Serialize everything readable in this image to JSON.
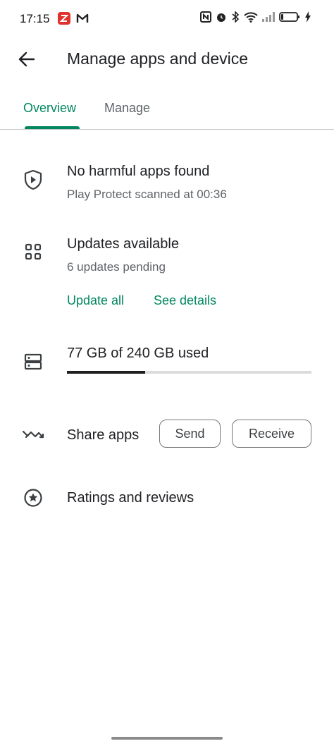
{
  "status_bar": {
    "time": "17:15",
    "left_icons": [
      "zoho-app-icon",
      "gmail-icon"
    ],
    "right_icons": [
      "nfc-icon",
      "alarm-icon",
      "bluetooth-icon",
      "wifi-icon",
      "signal-icon",
      "battery-icon",
      "charging-icon"
    ]
  },
  "header": {
    "title": "Manage apps and device"
  },
  "tabs": [
    {
      "label": "Overview",
      "selected": true
    },
    {
      "label": "Manage",
      "selected": false
    }
  ],
  "protect": {
    "title": "No harmful apps found",
    "subtitle": "Play Protect scanned at 00:36"
  },
  "updates": {
    "title": "Updates available",
    "subtitle": "6 updates pending",
    "update_all_label": "Update all",
    "see_details_label": "See details"
  },
  "storage": {
    "label": "77 GB of 240 GB used",
    "used_gb": 77,
    "total_gb": 240
  },
  "share": {
    "label": "Share apps",
    "send_label": "Send",
    "receive_label": "Receive"
  },
  "ratings": {
    "label": "Ratings and reviews"
  },
  "colors": {
    "accent": "#01875f",
    "text": "#202124",
    "secondary": "#5f6368"
  }
}
